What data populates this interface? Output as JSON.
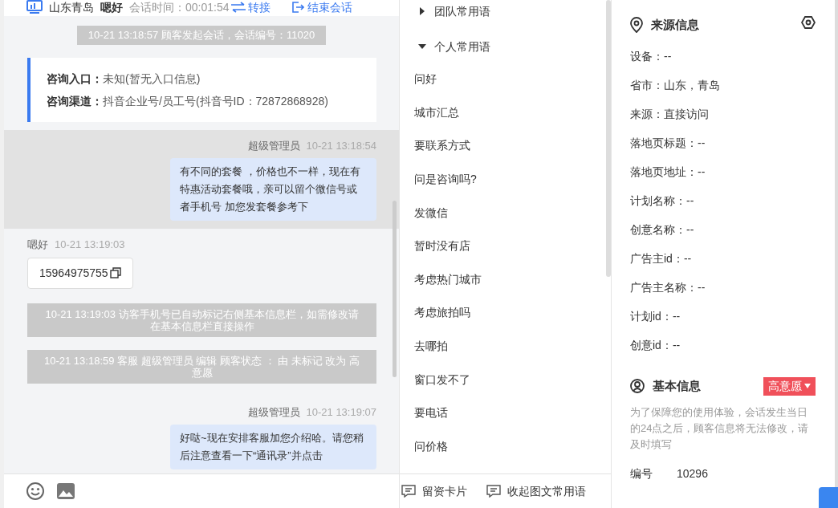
{
  "chat_header": {
    "location": "山东青岛",
    "visitor": "嗯好",
    "duration_label": "会话时间：",
    "duration": "00:01:54",
    "transfer": "转接",
    "end": "结束会话"
  },
  "messages": [
    {
      "kind": "system",
      "text": "10-21 13:18:57 顾客发起会话，会话编号：11020"
    },
    {
      "kind": "info",
      "lines": [
        {
          "label": "咨询入口：",
          "value": "未知(暂无入口信息)"
        },
        {
          "label": "咨询渠道：",
          "value": "抖音企业号/员工号(抖音号ID：72872868928)"
        }
      ]
    },
    {
      "kind": "agent",
      "sender": "超级管理员",
      "time": "10-21 13:18:54",
      "text": "有不同的套餐 ，价格也不一样，现在有特惠活动套餐哦，亲可以留个微信号或者手机号 加您发套餐参考下",
      "selected": true
    },
    {
      "kind": "visitor",
      "sender": "嗯好",
      "time": "10-21 13:19:03",
      "text": "15964975755",
      "selected": false
    },
    {
      "kind": "notice",
      "text": "10-21 13:19:03 访客手机号已自动标记右侧基本信息栏，如需修改请在基本信息栏直接操作"
    },
    {
      "kind": "notice",
      "text": "10-21 13:18:59 客服 超级管理员 编辑 顾客状态 ： 由 未标记 改为 高意愿"
    },
    {
      "kind": "agent",
      "sender": "超级管理员",
      "time": "10-21 13:19:07",
      "text": "好哒~现在安排客服加您介绍哈。请您稍后注意查看一下“通讯录”并点击",
      "selected": false
    }
  ],
  "phrases": {
    "groups": [
      {
        "label": "团队常用语",
        "expanded": false
      },
      {
        "label": "个人常用语",
        "expanded": true,
        "children": [
          {
            "label": "问好"
          },
          {
            "label": "城市汇总"
          },
          {
            "label": "要联系方式"
          },
          {
            "label": "问是咨询吗?"
          },
          {
            "label": "发微信"
          },
          {
            "label": "暂时没有店"
          },
          {
            "label": "考虑热门城市"
          },
          {
            "label": "考虑旅拍吗"
          },
          {
            "label": "去哪拍"
          },
          {
            "label": "窗口发不了"
          },
          {
            "label": "要电话"
          },
          {
            "label": "问价格"
          }
        ]
      }
    ],
    "footer": [
      "留资卡片",
      "收起图文常用语"
    ]
  },
  "source_info": {
    "title": "来源信息",
    "fields": [
      "设备：--",
      "省市：山东，青岛",
      "来源：直接访问",
      "落地页标题：--",
      "落地页地址：--",
      "计划名称：--",
      "创意名称：--",
      "广告主id：--",
      "广告主名称：--",
      "计划id：--",
      "创意id：--"
    ]
  },
  "basic_info": {
    "title": "基本信息",
    "status": "高意愿",
    "note": "为了保障您的使用体验，会话发生当日的24点之后，顾客信息将无法修改，请及时填写",
    "fields": [
      {
        "label": "编号",
        "value": "10296"
      }
    ]
  }
}
